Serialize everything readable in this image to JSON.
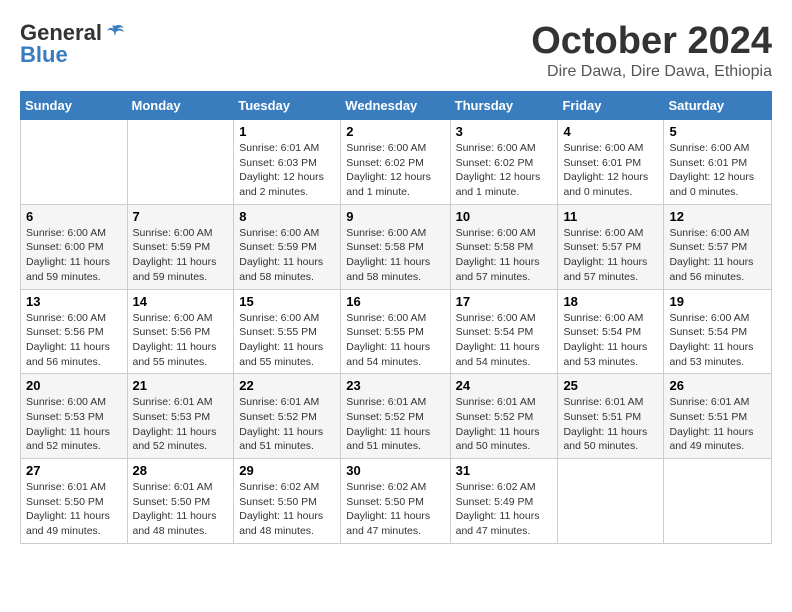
{
  "header": {
    "logo_general": "General",
    "logo_blue": "Blue",
    "month": "October 2024",
    "location": "Dire Dawa, Dire Dawa, Ethiopia"
  },
  "days_of_week": [
    "Sunday",
    "Monday",
    "Tuesday",
    "Wednesday",
    "Thursday",
    "Friday",
    "Saturday"
  ],
  "weeks": [
    [
      {
        "day": "",
        "info": ""
      },
      {
        "day": "",
        "info": ""
      },
      {
        "day": "1",
        "info": "Sunrise: 6:01 AM\nSunset: 6:03 PM\nDaylight: 12 hours and 2 minutes."
      },
      {
        "day": "2",
        "info": "Sunrise: 6:00 AM\nSunset: 6:02 PM\nDaylight: 12 hours and 1 minute."
      },
      {
        "day": "3",
        "info": "Sunrise: 6:00 AM\nSunset: 6:02 PM\nDaylight: 12 hours and 1 minute."
      },
      {
        "day": "4",
        "info": "Sunrise: 6:00 AM\nSunset: 6:01 PM\nDaylight: 12 hours and 0 minutes."
      },
      {
        "day": "5",
        "info": "Sunrise: 6:00 AM\nSunset: 6:01 PM\nDaylight: 12 hours and 0 minutes."
      }
    ],
    [
      {
        "day": "6",
        "info": "Sunrise: 6:00 AM\nSunset: 6:00 PM\nDaylight: 11 hours and 59 minutes."
      },
      {
        "day": "7",
        "info": "Sunrise: 6:00 AM\nSunset: 5:59 PM\nDaylight: 11 hours and 59 minutes."
      },
      {
        "day": "8",
        "info": "Sunrise: 6:00 AM\nSunset: 5:59 PM\nDaylight: 11 hours and 58 minutes."
      },
      {
        "day": "9",
        "info": "Sunrise: 6:00 AM\nSunset: 5:58 PM\nDaylight: 11 hours and 58 minutes."
      },
      {
        "day": "10",
        "info": "Sunrise: 6:00 AM\nSunset: 5:58 PM\nDaylight: 11 hours and 57 minutes."
      },
      {
        "day": "11",
        "info": "Sunrise: 6:00 AM\nSunset: 5:57 PM\nDaylight: 11 hours and 57 minutes."
      },
      {
        "day": "12",
        "info": "Sunrise: 6:00 AM\nSunset: 5:57 PM\nDaylight: 11 hours and 56 minutes."
      }
    ],
    [
      {
        "day": "13",
        "info": "Sunrise: 6:00 AM\nSunset: 5:56 PM\nDaylight: 11 hours and 56 minutes."
      },
      {
        "day": "14",
        "info": "Sunrise: 6:00 AM\nSunset: 5:56 PM\nDaylight: 11 hours and 55 minutes."
      },
      {
        "day": "15",
        "info": "Sunrise: 6:00 AM\nSunset: 5:55 PM\nDaylight: 11 hours and 55 minutes."
      },
      {
        "day": "16",
        "info": "Sunrise: 6:00 AM\nSunset: 5:55 PM\nDaylight: 11 hours and 54 minutes."
      },
      {
        "day": "17",
        "info": "Sunrise: 6:00 AM\nSunset: 5:54 PM\nDaylight: 11 hours and 54 minutes."
      },
      {
        "day": "18",
        "info": "Sunrise: 6:00 AM\nSunset: 5:54 PM\nDaylight: 11 hours and 53 minutes."
      },
      {
        "day": "19",
        "info": "Sunrise: 6:00 AM\nSunset: 5:54 PM\nDaylight: 11 hours and 53 minutes."
      }
    ],
    [
      {
        "day": "20",
        "info": "Sunrise: 6:00 AM\nSunset: 5:53 PM\nDaylight: 11 hours and 52 minutes."
      },
      {
        "day": "21",
        "info": "Sunrise: 6:01 AM\nSunset: 5:53 PM\nDaylight: 11 hours and 52 minutes."
      },
      {
        "day": "22",
        "info": "Sunrise: 6:01 AM\nSunset: 5:52 PM\nDaylight: 11 hours and 51 minutes."
      },
      {
        "day": "23",
        "info": "Sunrise: 6:01 AM\nSunset: 5:52 PM\nDaylight: 11 hours and 51 minutes."
      },
      {
        "day": "24",
        "info": "Sunrise: 6:01 AM\nSunset: 5:52 PM\nDaylight: 11 hours and 50 minutes."
      },
      {
        "day": "25",
        "info": "Sunrise: 6:01 AM\nSunset: 5:51 PM\nDaylight: 11 hours and 50 minutes."
      },
      {
        "day": "26",
        "info": "Sunrise: 6:01 AM\nSunset: 5:51 PM\nDaylight: 11 hours and 49 minutes."
      }
    ],
    [
      {
        "day": "27",
        "info": "Sunrise: 6:01 AM\nSunset: 5:50 PM\nDaylight: 11 hours and 49 minutes."
      },
      {
        "day": "28",
        "info": "Sunrise: 6:01 AM\nSunset: 5:50 PM\nDaylight: 11 hours and 48 minutes."
      },
      {
        "day": "29",
        "info": "Sunrise: 6:02 AM\nSunset: 5:50 PM\nDaylight: 11 hours and 48 minutes."
      },
      {
        "day": "30",
        "info": "Sunrise: 6:02 AM\nSunset: 5:50 PM\nDaylight: 11 hours and 47 minutes."
      },
      {
        "day": "31",
        "info": "Sunrise: 6:02 AM\nSunset: 5:49 PM\nDaylight: 11 hours and 47 minutes."
      },
      {
        "day": "",
        "info": ""
      },
      {
        "day": "",
        "info": ""
      }
    ]
  ]
}
